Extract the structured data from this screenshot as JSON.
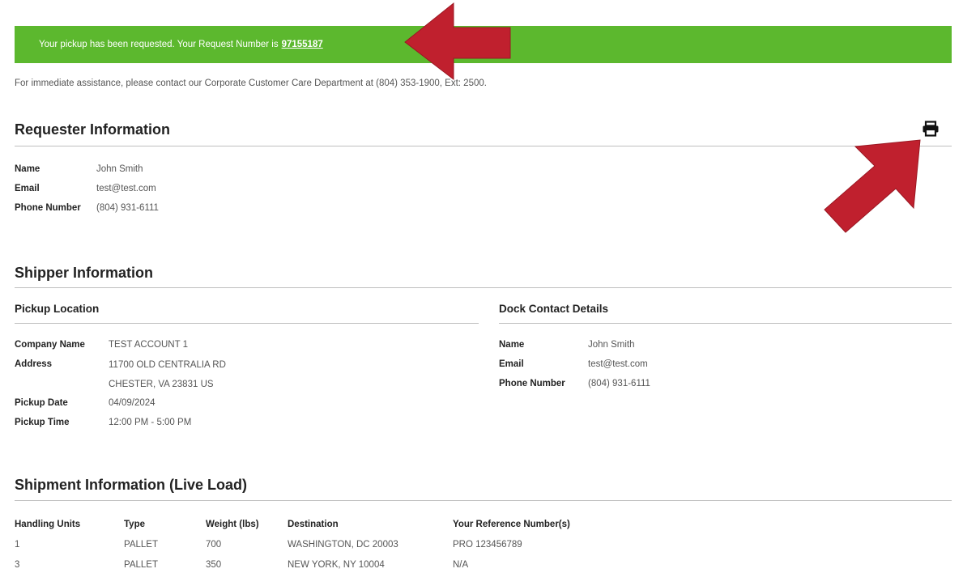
{
  "banner": {
    "message": "Your pickup has been requested. Your Request Number is",
    "request_number": "97155187"
  },
  "assistance": "For immediate assistance, please contact our Corporate Customer Care Department at (804) 353-1900, Ext: 2500.",
  "icons": {
    "print": "print-icon",
    "arrow": "red-arrow-annotation"
  },
  "requester": {
    "title": "Requester Information",
    "fields": [
      {
        "label": "Name",
        "value": "John Smith"
      },
      {
        "label": "Email",
        "value": "test@test.com"
      },
      {
        "label": "Phone Number",
        "value": "(804) 931-6111"
      }
    ]
  },
  "shipper": {
    "title": "Shipper Information",
    "pickup_location": {
      "title": "Pickup Location",
      "fields": [
        {
          "label": "Company Name",
          "value": "TEST ACCOUNT 1"
        },
        {
          "label": "Address",
          "value": "11700 OLD CENTRALIA RD",
          "value2": "CHESTER, VA 23831 US"
        },
        {
          "label": "Pickup Date",
          "value": "04/09/2024"
        },
        {
          "label": "Pickup Time",
          "value": "12:00 PM - 5:00 PM"
        }
      ]
    },
    "dock_contact": {
      "title": "Dock Contact Details",
      "fields": [
        {
          "label": "Name",
          "value": "John Smith"
        },
        {
          "label": "Email",
          "value": "test@test.com"
        },
        {
          "label": "Phone Number",
          "value": "(804) 931-6111"
        }
      ]
    }
  },
  "shipment": {
    "title": "Shipment Information (Live Load)",
    "columns": [
      "Handling Units",
      "Type",
      "Weight (lbs)",
      "Destination",
      "Your Reference Number(s)"
    ],
    "rows": [
      [
        "1",
        "PALLET",
        "700",
        "WASHINGTON, DC 20003",
        "PRO 123456789"
      ],
      [
        "3",
        "PALLET",
        "350",
        "NEW YORK, NY 10004",
        "N/A"
      ]
    ]
  },
  "colors": {
    "banner": "#5cb82e",
    "arrow": "#c0202e",
    "rule": "#bfbfbf"
  }
}
